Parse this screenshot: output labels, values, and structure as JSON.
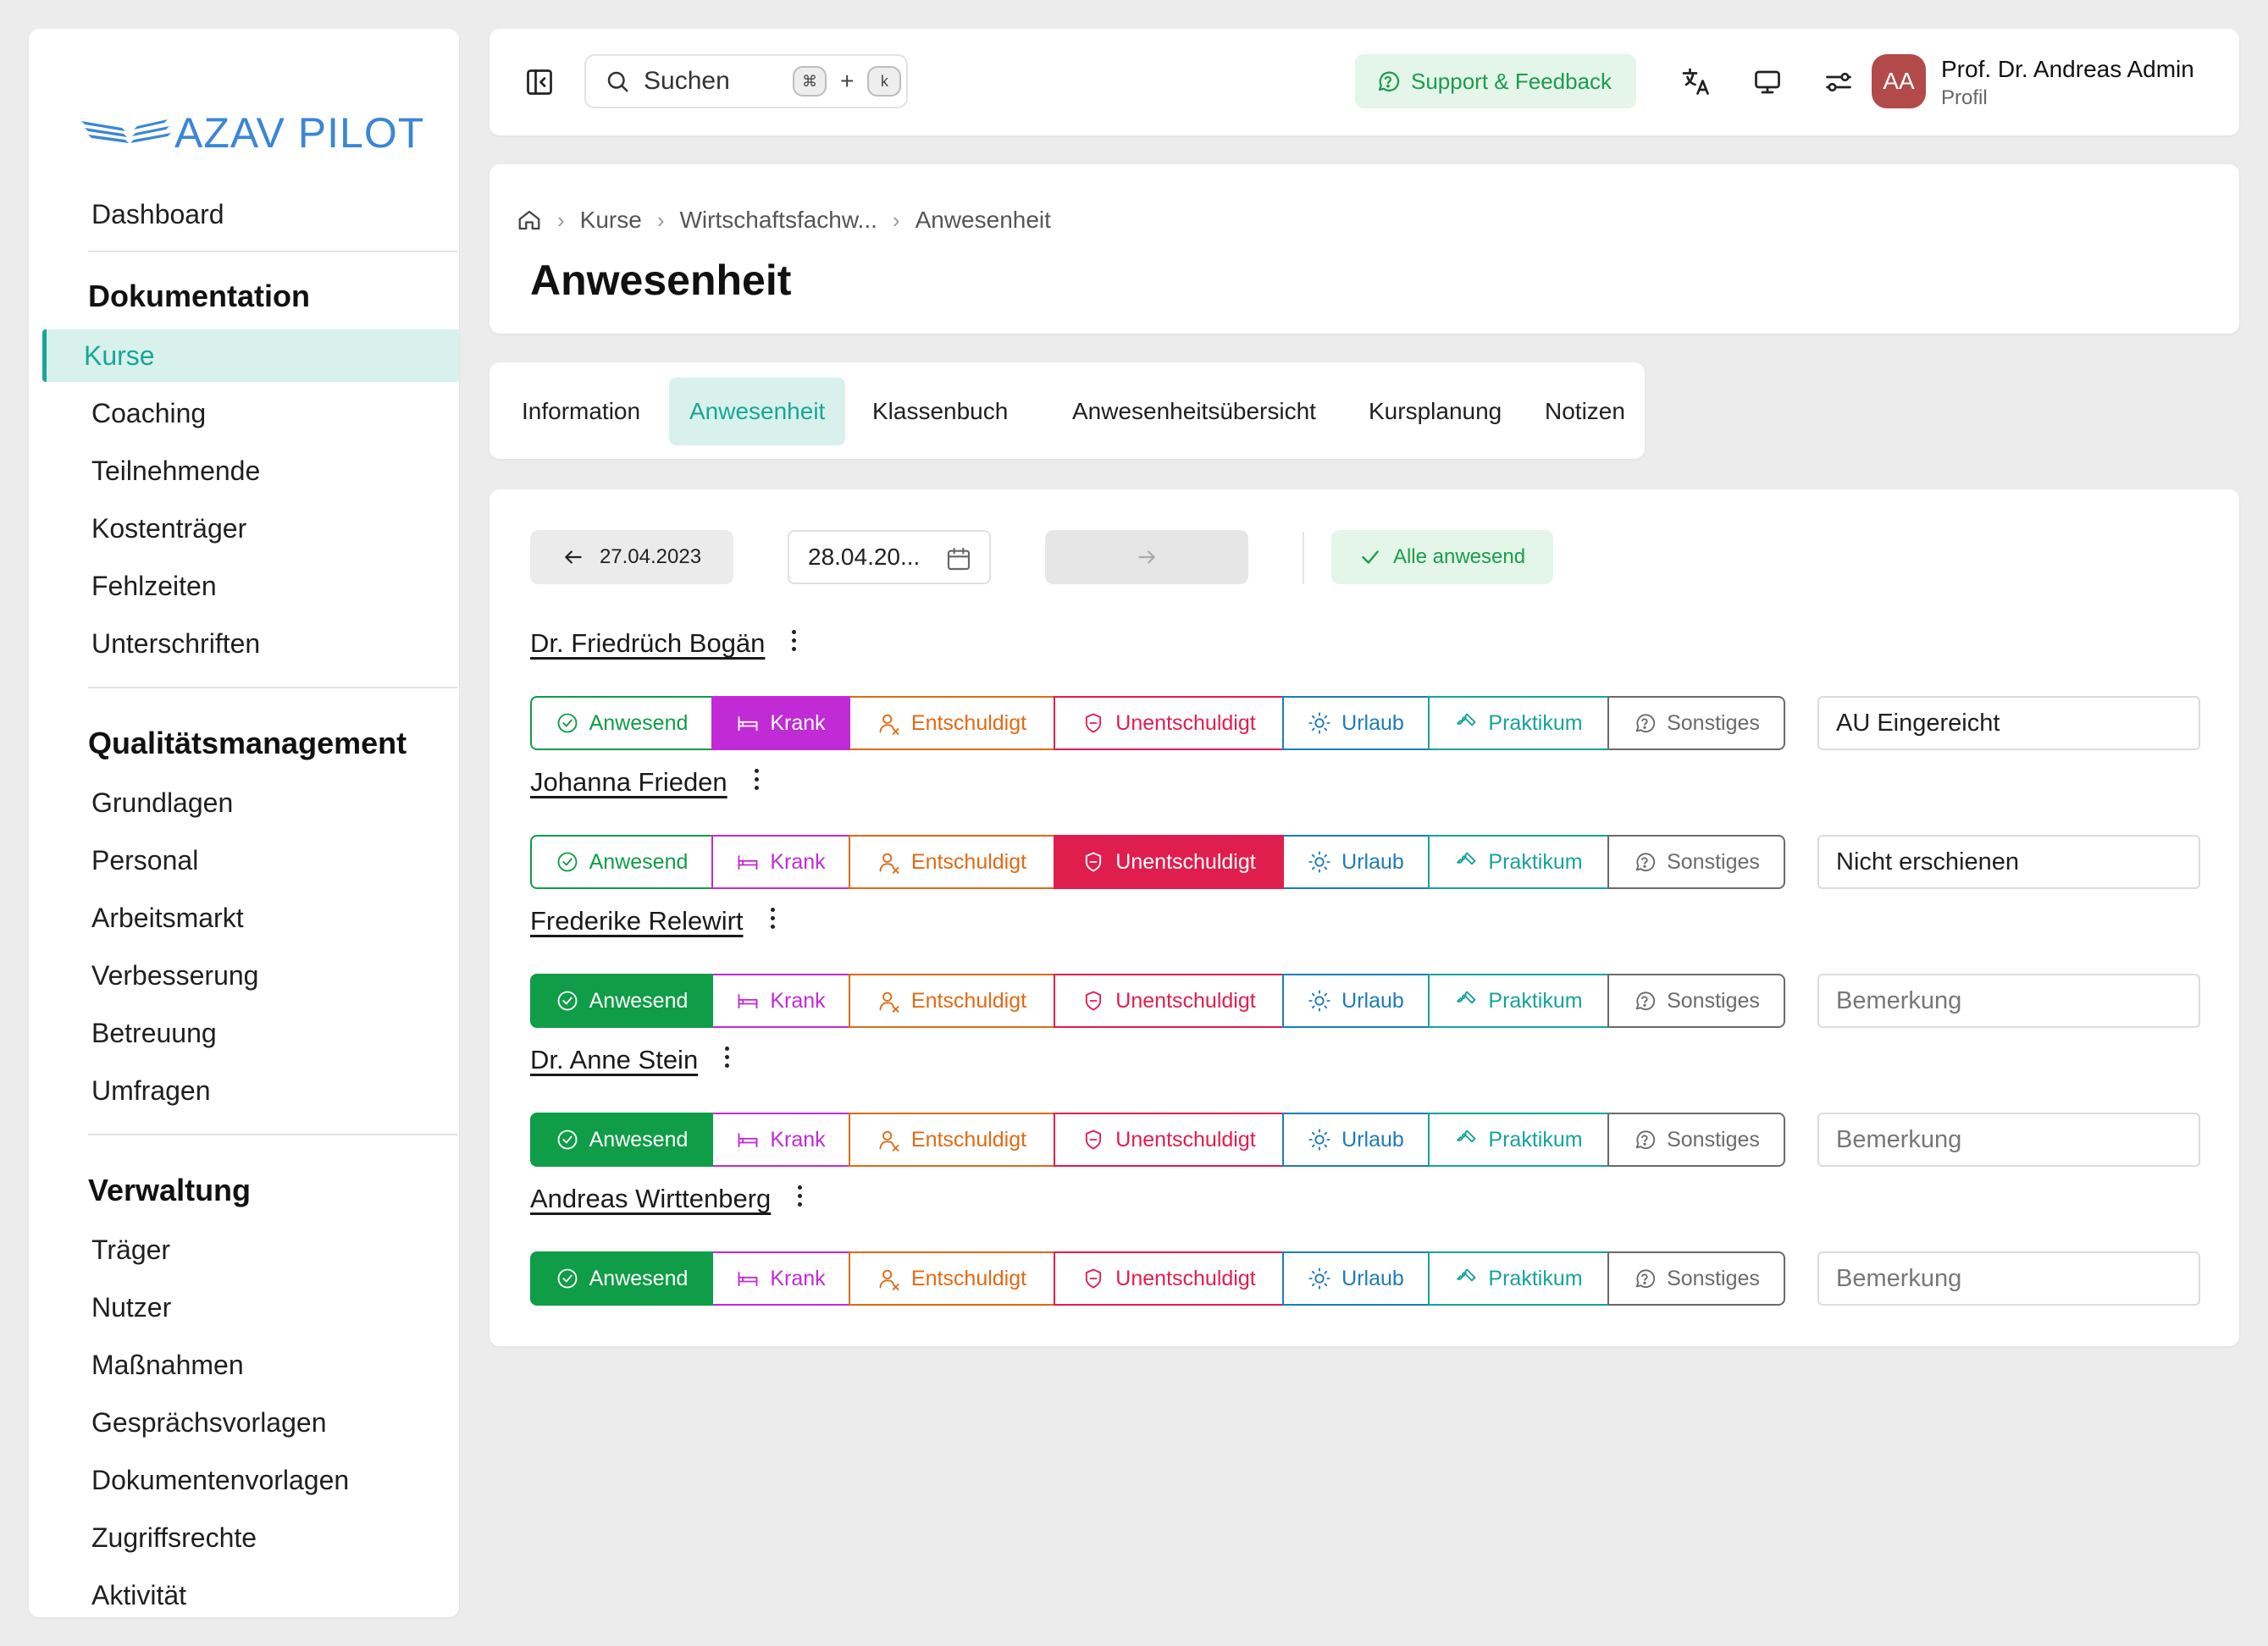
{
  "app": {
    "logo_text": "AZAV PILOT",
    "brand_color": "#3b86d6",
    "accent_color": "#1aa596"
  },
  "sidebar": {
    "top_items": [
      {
        "label": "Dashboard"
      }
    ],
    "sections": [
      {
        "title": "Dokumentation",
        "items": [
          "Kurse",
          "Coaching",
          "Teilnehmende",
          "Kostenträger",
          "Fehlzeiten",
          "Unterschriften"
        ]
      },
      {
        "title": "Qualitätsmanagement",
        "items": [
          "Grundlagen",
          "Personal",
          "Arbeitsmarkt",
          "Verbesserung",
          "Betreuung",
          "Umfragen"
        ]
      },
      {
        "title": "Verwaltung",
        "items": [
          "Träger",
          "Nutzer",
          "Maßnahmen",
          "Gesprächsvorlagen",
          "Dokumentenvorlagen",
          "Zugriffsrechte",
          "Aktivität"
        ]
      }
    ],
    "active_item": "Kurse"
  },
  "topbar": {
    "search_label": "Suchen",
    "shortcut_key1": "⌘",
    "shortcut_plus": "+",
    "shortcut_key2": "k",
    "support_label": "Support & Feedback",
    "user_initials": "AA",
    "user_name": "Prof. Dr. Andreas Admin",
    "user_role": "Profil"
  },
  "breadcrumb": {
    "items": [
      "Kurse",
      "Wirtschaftsfachw...",
      "Anwesenheit"
    ]
  },
  "page_title": "Anwesenheit",
  "tabs": {
    "items": [
      "Information",
      "Anwesenheit",
      "Klassenbuch",
      "Anwesenheitsübersicht",
      "Kursplanung",
      "Notizen"
    ],
    "active": "Anwesenheit"
  },
  "controls": {
    "prev_date": "27.04.2023",
    "current_date": "28.04.20...",
    "all_present_label": "Alle anwesend"
  },
  "status_options": [
    {
      "key": "anwesend",
      "label": "Anwesend",
      "color": "#0f9d47",
      "icon": "check-circle-icon"
    },
    {
      "key": "krank",
      "label": "Krank",
      "color": "#c02bd6",
      "icon": "bed-icon"
    },
    {
      "key": "entschuldigt",
      "label": "Entschuldigt",
      "color": "#e06a14",
      "icon": "user-x-icon"
    },
    {
      "key": "unentschuldigt",
      "label": "Unentschuldigt",
      "color": "#e01e4e",
      "icon": "shield-icon"
    },
    {
      "key": "urlaub",
      "label": "Urlaub",
      "color": "#1d7cb8",
      "icon": "sun-icon"
    },
    {
      "key": "praktikum",
      "label": "Praktikum",
      "color": "#16a39a",
      "icon": "wrench-icon"
    },
    {
      "key": "sonstiges",
      "label": "Sonstiges",
      "color": "#6b6b6b",
      "icon": "help-circle-icon"
    }
  ],
  "remark_placeholder": "Bemerkung",
  "participants": [
    {
      "name": "Dr. Friedrüch Bogän",
      "status": "krank",
      "remark": "AU Eingereicht"
    },
    {
      "name": "Johanna Frieden",
      "status": "unentschuldigt",
      "remark": "Nicht erschienen"
    },
    {
      "name": "Frederike Relewirt",
      "status": "anwesend",
      "remark": ""
    },
    {
      "name": "Dr. Anne Stein",
      "status": "anwesend",
      "remark": ""
    },
    {
      "name": "Andreas Wirttenberg",
      "status": "anwesend",
      "remark": ""
    }
  ]
}
